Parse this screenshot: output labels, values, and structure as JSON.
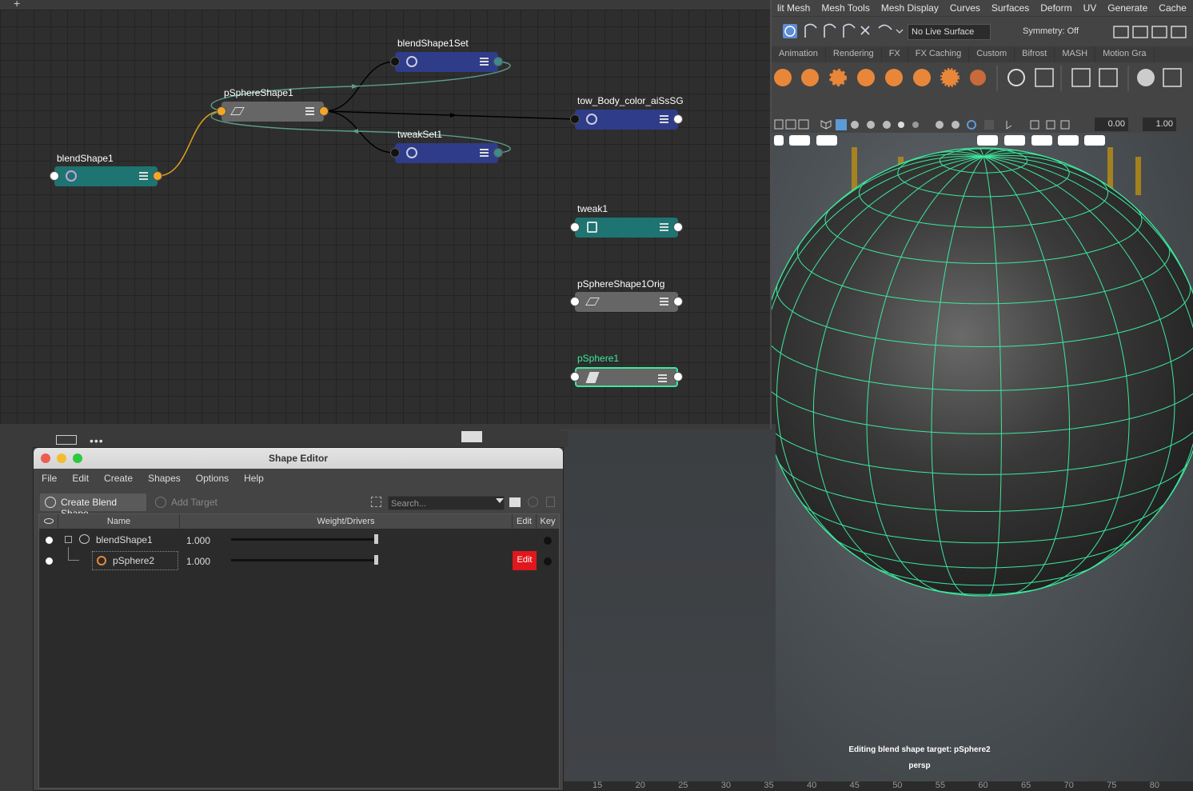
{
  "maya_menu": [
    "lit Mesh",
    "Mesh Tools",
    "Mesh Display",
    "Curves",
    "Surfaces",
    "Deform",
    "UV",
    "Generate",
    "Cache"
  ],
  "statusline": {
    "live_surface": "No Live Surface",
    "symmetry": "Symmetry: Off"
  },
  "shelf_tabs": [
    "Animation",
    "Rendering",
    "FX",
    "FX Caching",
    "Custom",
    "Bifrost",
    "MASH",
    "Motion Gra"
  ],
  "panel_toolbar": {
    "value1": "0.00",
    "value2": "1.00"
  },
  "nodes": {
    "blendShape1Set": "blendShape1Set",
    "pSphereShape1": "pSphereShape1",
    "tow_body": "tow_Body_color_aiSsSG",
    "tweakSet1": "tweakSet1",
    "blendShape1": "blendShape1",
    "tweak1": "tweak1",
    "pSphereShape1Orig": "pSphereShape1Orig",
    "pSphere1": "pSphere1"
  },
  "colors": {
    "node_blue": "#2f3c8a",
    "node_teal": "#1d7471",
    "node_gray": "#666666",
    "port_orange": "#f5a623",
    "wire_green": "#5c9c8a",
    "wire_orange": "#e0a020",
    "selection_green": "#3de89d",
    "edit_red": "#e0171c"
  },
  "shape_editor": {
    "title": "Shape Editor",
    "menu": [
      "File",
      "Edit",
      "Create",
      "Shapes",
      "Options",
      "Help"
    ],
    "create_blend_shape": "Create Blend Shape",
    "add_target": "Add Target",
    "search_placeholder": "Search...",
    "columns": {
      "name": "Name",
      "weight": "Weight/Drivers",
      "edit": "Edit",
      "key": "Key"
    },
    "rows": [
      {
        "name": "blendShape1",
        "weight": "1.000",
        "slider": 1.0
      },
      {
        "name": "pSphere2",
        "weight": "1.000",
        "slider": 1.0,
        "edit_label": "Edit"
      }
    ]
  },
  "viewport": {
    "status": "Editing blend shape target: pSphere2",
    "camera": "persp"
  },
  "timeline_ticks": [
    "15",
    "20",
    "25",
    "30",
    "35",
    "40",
    "45",
    "50",
    "55",
    "60",
    "65",
    "70",
    "75",
    "80"
  ]
}
